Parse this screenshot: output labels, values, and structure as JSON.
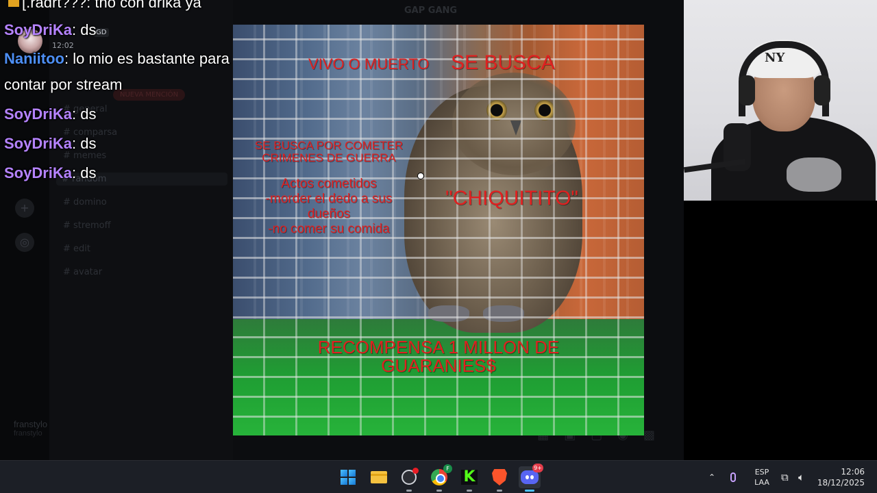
{
  "chat": {
    "top_partial": {
      "text": "[.radrt???: tnó con drika ya"
    },
    "messages": [
      {
        "user": "SoyDriKa",
        "text": ": ds",
        "color": "#b583ff"
      },
      {
        "user": "Naniitoo",
        "text": ": lo mio es bastante para",
        "color": "#4d8ff5"
      },
      {
        "user": "",
        "text": "contar por stream",
        "color": "#ffffff"
      },
      {
        "user": "SoyDriKa",
        "text": ": ds",
        "color": "#b583ff"
      },
      {
        "user": "SoyDriKa",
        "text": ": ds",
        "color": "#b583ff"
      },
      {
        "user": "SoyDriKa",
        "text": ": ds",
        "color": "#b583ff"
      }
    ],
    "overlay_tag": "GD",
    "overlay_time": "12:02"
  },
  "discord_background": {
    "server_name": "GAP GANG",
    "new_mentions_badge": "NUEVA MENCIÓN",
    "channels": [
      "general",
      "comparsa",
      "memes",
      "random",
      "domino",
      "stremoff",
      "edit",
      "avatar"
    ],
    "user": {
      "name": "franstylo",
      "status": "franstylo"
    }
  },
  "poster": {
    "title": "SE BUSCA",
    "subtitle": "VIVO O MUERTO",
    "crimes": "SE BUSCA POR COMETER CRIMENES DE GUERRA",
    "acts": [
      "Actos cometidos",
      "-morder el dedo a sus dueños",
      "-no comer su comida"
    ],
    "name": "\"CHIQUITITO\"",
    "reward": "RECOMPENSA 1 MILLON DE GUARANIES$",
    "text_color": "#e02020"
  },
  "webcam": {
    "cap_logo": "NY"
  },
  "taskbar": {
    "apps": [
      {
        "name": "start",
        "icon": "windows-logo-icon"
      },
      {
        "name": "file-explorer",
        "icon": "folder-icon"
      },
      {
        "name": "obs",
        "icon": "obs-icon"
      },
      {
        "name": "chrome",
        "icon": "chrome-icon",
        "badge": "F"
      },
      {
        "name": "kick",
        "icon": "kick-icon",
        "letter": "K"
      },
      {
        "name": "brave",
        "icon": "brave-icon"
      },
      {
        "name": "discord",
        "icon": "discord-icon",
        "badge": "9+"
      }
    ],
    "tray": {
      "lang_line1": "ESP",
      "lang_line2": "LAA",
      "time": "12:06",
      "date": "18/12/2025"
    }
  }
}
